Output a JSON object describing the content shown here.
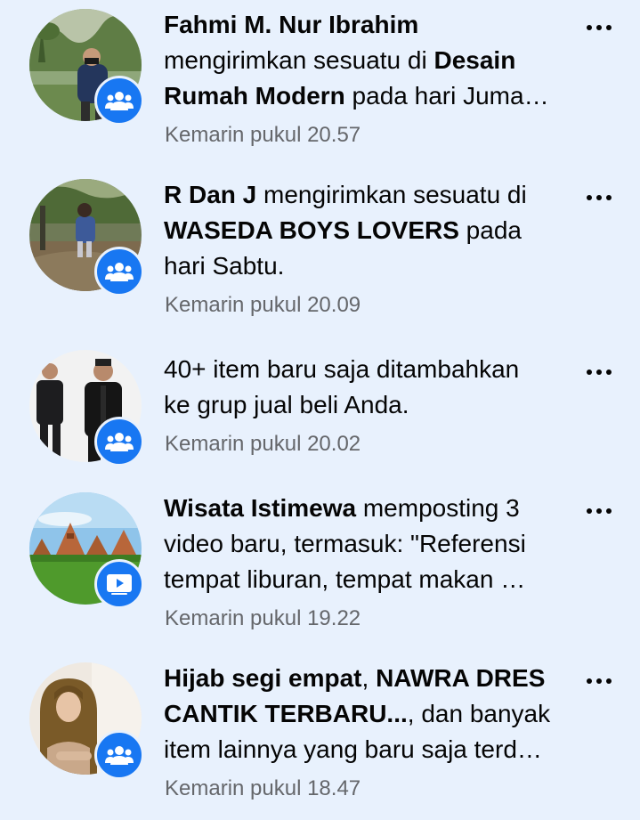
{
  "notifications": [
    {
      "lines": [
        [
          {
            "t": "Fahmi M. Nur Ibrahim",
            "b": true
          }
        ],
        [
          {
            "t": "mengirimkan sesuatu di ",
            "b": false
          },
          {
            "t": "Desain",
            "b": true
          }
        ],
        [
          {
            "t": "Rumah Modern",
            "b": true
          },
          {
            "t": " pada hari Juma…",
            "b": false
          }
        ]
      ],
      "time": "Kemarin pukul 20.57",
      "badge_icon": "group-icon"
    },
    {
      "lines": [
        [
          {
            "t": "R Dan J",
            "b": true
          },
          {
            "t": " mengirimkan sesuatu di",
            "b": false
          }
        ],
        [
          {
            "t": "WASEDA BOYS LOVERS",
            "b": true
          },
          {
            "t": " pada",
            "b": false
          }
        ],
        [
          {
            "t": "hari Sabtu.",
            "b": false
          }
        ]
      ],
      "time": "Kemarin pukul 20.09",
      "badge_icon": "group-icon"
    },
    {
      "lines": [
        [
          {
            "t": "40+ item baru saja ditambahkan",
            "b": false
          }
        ],
        [
          {
            "t": "ke grup jual beli Anda.",
            "b": false
          }
        ]
      ],
      "time": "Kemarin pukul 20.02",
      "badge_icon": "group-icon"
    },
    {
      "lines": [
        [
          {
            "t": "Wisata Istimewa",
            "b": true
          },
          {
            "t": " memposting 3",
            "b": false
          }
        ],
        [
          {
            "t": "video baru, termasuk: \"Referensi",
            "b": false
          }
        ],
        [
          {
            "t": "tempat liburan, tempat makan …",
            "b": false
          }
        ]
      ],
      "time": "Kemarin pukul 19.22",
      "badge_icon": "video-icon"
    },
    {
      "lines": [
        [
          {
            "t": "Hijab segi empat",
            "b": true
          },
          {
            "t": ", ",
            "b": false
          },
          {
            "t": "NAWRA DRES",
            "b": true
          }
        ],
        [
          {
            "t": "CANTIK TERBARU...",
            "b": true
          },
          {
            "t": ", dan banyak",
            "b": false
          }
        ],
        [
          {
            "t": "item lainnya yang baru saja terd…",
            "b": false
          }
        ]
      ],
      "time": "Kemarin pukul 18.47",
      "badge_icon": "group-icon"
    }
  ],
  "colors": {
    "background": "#e8f1fd",
    "badge": "#1877f2",
    "primary_text": "#050505",
    "secondary_text": "#65676b"
  }
}
